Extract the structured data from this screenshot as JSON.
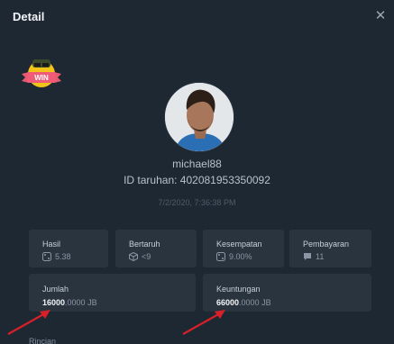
{
  "header": {
    "title": "Detail"
  },
  "user": {
    "username": "michael88"
  },
  "bet": {
    "id_label": "ID taruhan:",
    "id_value": "402081953350092",
    "timestamp": "7/2/2020, 7:36:38 PM"
  },
  "badge": {
    "text": "WIN"
  },
  "stats": [
    {
      "label": "Hasil",
      "value": "5.38",
      "icon": "dice-icon"
    },
    {
      "label": "Bertaruh",
      "value": "<9",
      "icon": "cube-icon"
    },
    {
      "label": "Kesempatan",
      "value": "9.00%",
      "icon": "dice-icon"
    },
    {
      "label": "Pembayaran",
      "value": "11",
      "icon": "chat-icon"
    }
  ],
  "amount": {
    "label": "Jumlah",
    "bold": "16000",
    "rest": ".0000",
    "currency": "JB"
  },
  "profit": {
    "label": "Keuntungan",
    "bold": "66000",
    "rest": ".0000",
    "currency": "JB"
  },
  "footer": {
    "details_label": "Rincian"
  },
  "colors": {
    "background": "#1e2833",
    "card": "#29343f",
    "arrow": "#d6202a",
    "badge": "#f2c318"
  }
}
